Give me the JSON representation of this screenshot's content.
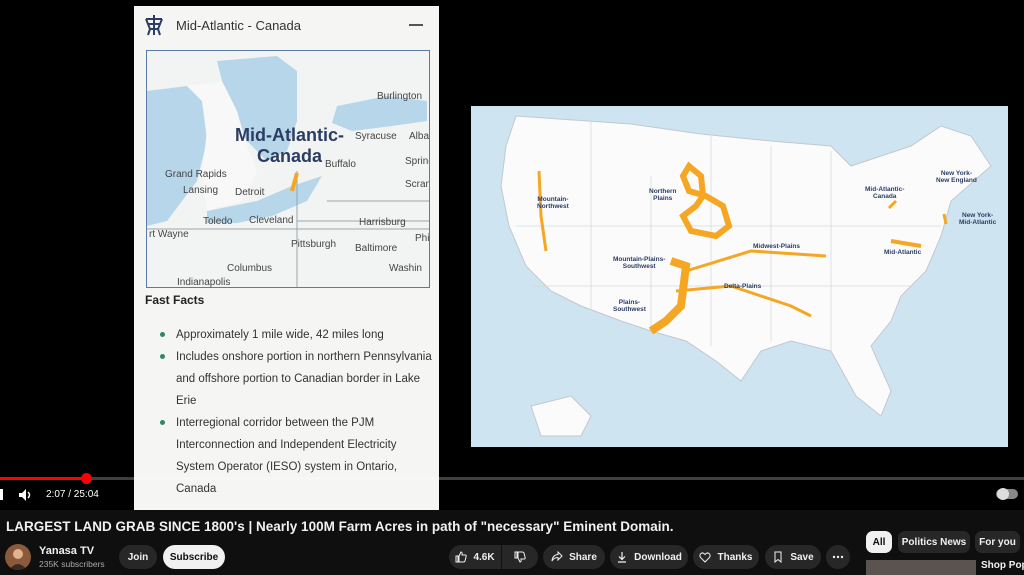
{
  "panel": {
    "title": "Mid-Atlantic - Canada",
    "inset_title_line1": "Mid-Atlantic-",
    "inset_title_line2": "Canada",
    "inset_places": [
      "Burlington",
      "Syracuse",
      "Alba",
      "Buffalo",
      "Spring",
      "Grand Rapids",
      "Lansing",
      "Detroit",
      "Scran",
      "Toledo",
      "Cleveland",
      "Harrisburg",
      "Phi",
      "rt Wayne",
      "Pittsburgh",
      "Baltimore",
      "Columbus",
      "Washin",
      "Indianapolis"
    ],
    "fast_facts_title": "Fast Facts",
    "facts": [
      "Approximately 1 mile wide, 42 miles long",
      "Includes onshore portion in northern Pennsylvania and offshore portion to Canadian border in Lake Erie",
      "Interregional corridor between the PJM Interconnection and Independent Electricity System Operator (IESO) system in Ontario, Canada"
    ]
  },
  "us_map": {
    "regions": [
      {
        "line1": "Mountain-",
        "line2": "Northwest"
      },
      {
        "line1": "Northern",
        "line2": "Plains"
      },
      {
        "line1": "Mid-Atlantic-",
        "line2": "Canada"
      },
      {
        "line1": "New York-",
        "line2": "New England"
      },
      {
        "line1": "New York-",
        "line2": "Mid-Atlantic"
      },
      {
        "line1": "Midwest-Plains",
        "line2": ""
      },
      {
        "line1": "Mid-Atlantic",
        "line2": ""
      },
      {
        "line1": "Mountain-Plains-",
        "line2": "Southwest"
      },
      {
        "line1": "Delta-Plains",
        "line2": ""
      },
      {
        "line1": "Plains-",
        "line2": "Southwest"
      }
    ]
  },
  "player": {
    "time": "2:07 / 25:04",
    "progress": 0.0845
  },
  "video": {
    "title": "LARGEST LAND GRAB SINCE 1800's | Nearly 100M Farm Acres in path of \"necessary\" Eminent Domain.",
    "channel": "Yanasa TV",
    "subscribers": "235K subscribers",
    "join_label": "Join",
    "subscribe_label": "Subscribe",
    "likes": "4.6K",
    "share_label": "Share",
    "download_label": "Download",
    "thanks_label": "Thanks",
    "save_label": "Save"
  },
  "chips": [
    "All",
    "Politics News",
    "For you"
  ],
  "related": {
    "title": "Shop Popu"
  },
  "colors": {
    "corridor": "#f5a623",
    "accent": "#ff0000",
    "panel_bg": "#f5f5f3"
  }
}
